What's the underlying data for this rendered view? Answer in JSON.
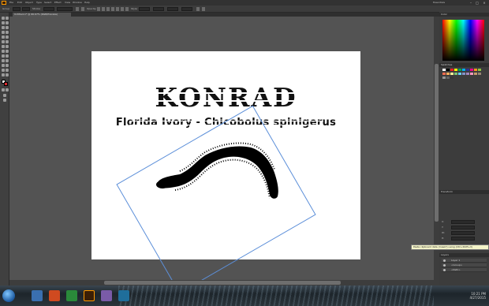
{
  "window": {
    "menu": [
      "File",
      "Edit",
      "Object",
      "Type",
      "Select",
      "Effect",
      "View",
      "Window",
      "Help"
    ],
    "workspace": "Essentials",
    "search_placeholder": ""
  },
  "control_bar": {
    "selection_label": "Group",
    "stroke_label": "Stroke:",
    "opacity_label": "Opacity:",
    "style_label": "Style:"
  },
  "document_tab": {
    "label": "Untitled-1* @ 66.67% (RGB/Preview)"
  },
  "artboard": {
    "title": "KONRAD",
    "subtitle": "Florida Ivory - Chicobolus spinigerus"
  },
  "panels": {
    "color_head": "Color",
    "swatches_head": "Swatches",
    "properties_head": "Transform",
    "layers_head": "Layers",
    "props": [
      {
        "label": "X:",
        "value": ""
      },
      {
        "label": "Y:",
        "value": ""
      },
      {
        "label": "W:",
        "value": ""
      },
      {
        "label": "H:",
        "value": ""
      }
    ],
    "layers": [
      "Layer 1",
      "<Group>",
      "<Path>"
    ]
  },
  "tooltip": "Paste clipboard data (mask?) using (Ctrl+Shift+V)",
  "taskbar": {
    "time": "10:21 PM",
    "date": "4/27/2015"
  },
  "colors": {
    "ui_dark": "#535353",
    "artboard": "#ffffff",
    "selection": "#5c8fd9",
    "app_accent": "#ff9a00"
  }
}
